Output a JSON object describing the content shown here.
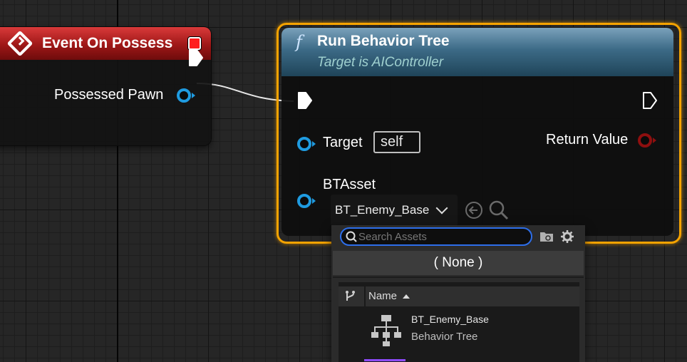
{
  "event_node": {
    "title": "Event On Possess",
    "output_pin_label": "Possessed Pawn"
  },
  "function_node": {
    "icon": "f",
    "title": "Run Behavior Tree",
    "subtitle": "Target is AIController",
    "target_label": "Target",
    "target_value": "self",
    "return_label": "Return Value",
    "btasset_label": "BTAsset",
    "btasset_value": "BT_Enemy_Base"
  },
  "asset_picker": {
    "search_placeholder": "Search Assets",
    "none_option": "( None )",
    "column_header": "Name",
    "items": [
      {
        "name": "BT_Enemy_Base",
        "type": "Behavior Tree"
      }
    ]
  },
  "colors": {
    "event_header": "#9e1717",
    "function_header": "#3c6a86",
    "selection_outline": "#f5a300",
    "object_pin": "#1f9be0",
    "return_pin": "#8e0f0f",
    "search_focus": "#2d6eea",
    "behavior_tree_accent": "#8f4bff"
  },
  "icons": [
    "event-diamond-icon",
    "delegate-icon",
    "exec-pin-icon",
    "object-pin-icon",
    "function-icon",
    "chevron-down-icon",
    "use-selected-icon",
    "browse-icon",
    "search-icon",
    "folder-icon",
    "gear-icon",
    "source-branch-icon",
    "sort-ascending-icon",
    "behavior-tree-icon"
  ]
}
